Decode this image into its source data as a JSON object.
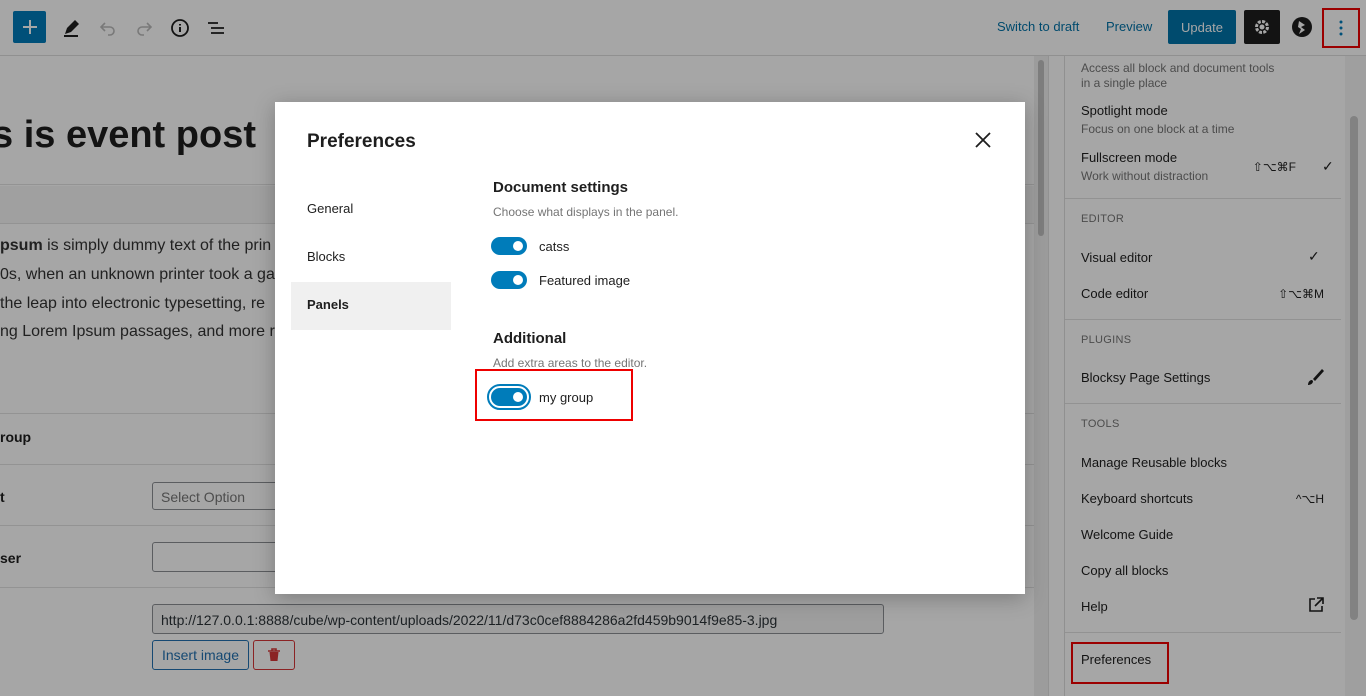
{
  "toolbar": {
    "switch_to_draft": "Switch to draft",
    "preview": "Preview",
    "update": "Update"
  },
  "editor": {
    "post_title": "s is event post",
    "paragraph_lines": [
      {
        "bold": "psum",
        "rest": " is simply dummy text of the prin"
      },
      {
        "bold": "",
        "rest": "0s, when an unknown printer took a ga"
      },
      {
        "bold": "",
        "rest": " the leap into electronic typesetting, re"
      },
      {
        "bold": "",
        "rest": "ng Lorem Ipsum passages, and more r"
      }
    ],
    "meta_labels": [
      "roup",
      "t",
      "ser"
    ],
    "select_placeholder": "Select Option",
    "image_url": "http://127.0.0.1:8888/cube/wp-content/uploads/2022/11/d73c0cef8884286a2fd459b9014f9e85-3.jpg",
    "insert_image": "Insert image"
  },
  "menu": {
    "top_desc": "Access all block and document tools in a single place",
    "spotlight": {
      "label": "Spotlight mode",
      "desc": "Focus on one block at a time"
    },
    "fullscreen": {
      "label": "Fullscreen mode",
      "desc": "Work without distraction",
      "shortcut": "⇧⌥⌘F",
      "check": "✓"
    },
    "editor_title": "EDITOR",
    "visual_editor": {
      "label": "Visual editor",
      "check": "✓"
    },
    "code_editor": {
      "label": "Code editor",
      "shortcut": "⇧⌥⌘M"
    },
    "plugins_title": "PLUGINS",
    "blocksy": {
      "label": "Blocksy Page Settings"
    },
    "tools_title": "TOOLS",
    "manage_reusable": "Manage Reusable blocks",
    "keyboard_shortcuts": {
      "label": "Keyboard shortcuts",
      "shortcut": "^⌥H"
    },
    "welcome_guide": "Welcome Guide",
    "copy_all": "Copy all blocks",
    "help": "Help",
    "preferences": "Preferences"
  },
  "modal": {
    "title": "Preferences",
    "tabs": [
      {
        "label": "General",
        "active": false
      },
      {
        "label": "Blocks",
        "active": false
      },
      {
        "label": "Panels",
        "active": true
      }
    ],
    "document_settings": {
      "title": "Document settings",
      "desc": "Choose what displays in the panel.",
      "toggles": [
        {
          "label": "catss",
          "on": true
        },
        {
          "label": "Featured image",
          "on": true
        }
      ]
    },
    "additional": {
      "title": "Additional",
      "desc": "Add extra areas to the editor.",
      "toggles": [
        {
          "label": "my group",
          "on": true
        }
      ]
    }
  },
  "colors": {
    "accent": "#007cba",
    "highlight": "#ee0000",
    "overlay": "rgba(0,0,0,0.35)"
  }
}
